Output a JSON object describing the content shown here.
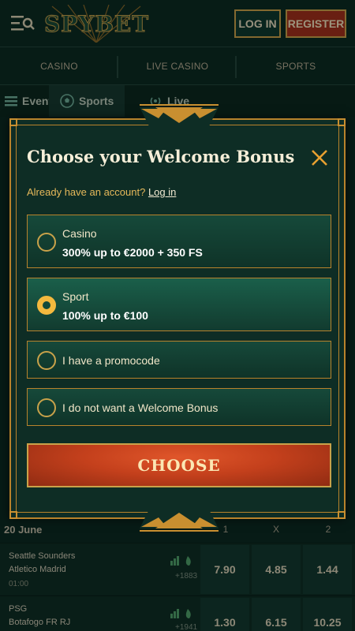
{
  "header": {
    "logo_text": "SPYBET",
    "login_label": "LOG IN",
    "register_label": "REGISTER"
  },
  "nav": [
    "CASINO",
    "LIVE CASINO",
    "SPORTS"
  ],
  "subnav": {
    "events": "Events",
    "sports": "Sports",
    "live": "Live"
  },
  "matches": {
    "date": "20 June",
    "columns": [
      "1",
      "X",
      "2"
    ],
    "rows": [
      {
        "team1": "Seattle Sounders",
        "team2": "Atletico Madrid",
        "time": "01:00",
        "more": "+1883",
        "odds": [
          "7.90",
          "4.85",
          "1.44"
        ]
      },
      {
        "team1": "PSG",
        "team2": "Botafogo FR RJ",
        "time": "",
        "more": "+1941",
        "odds": [
          "1.30",
          "6.15",
          "10.25"
        ]
      }
    ]
  },
  "modal": {
    "title": "Choose your Welcome Bonus",
    "account_prompt": "Already have an account?",
    "login_link": "Log in",
    "options": [
      {
        "label": "Casino",
        "detail": "300% up to €2000 + 350 FS",
        "selected": false
      },
      {
        "label": "Sport",
        "detail": "100% up to €100",
        "selected": true
      },
      {
        "label": "I have a promocode",
        "detail": "",
        "selected": false
      },
      {
        "label": "I do not want a Welcome Bonus",
        "detail": "",
        "selected": false
      }
    ],
    "choose_label": "CHOOSE"
  },
  "colors": {
    "accent_gold": "#c9a24a",
    "radio_selected": "#f4b93e",
    "choose_button": "#c4401c",
    "register_button": "#a1301c",
    "modal_background": "#0e2d25"
  },
  "icons": [
    "menu-search-icon",
    "close-icon",
    "soccer-ball-icon",
    "live-signal-icon",
    "list-icon",
    "stats-icon",
    "fire-icon"
  ]
}
